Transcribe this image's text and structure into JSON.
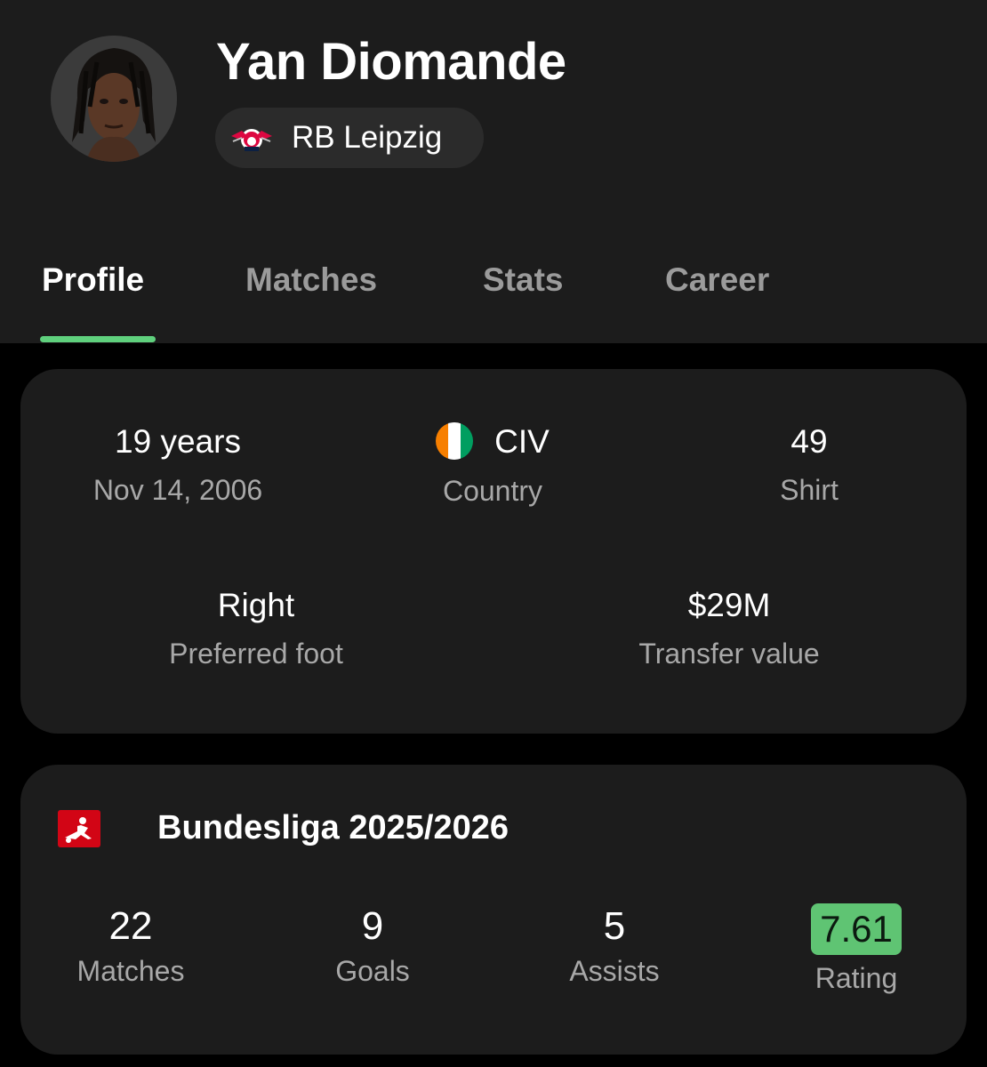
{
  "player": {
    "name": "Yan Diomande",
    "team": "RB Leipzig",
    "avatar_icon": "player-photo"
  },
  "tabs": [
    {
      "label": "Profile",
      "active": true
    },
    {
      "label": "Matches",
      "active": false
    },
    {
      "label": "Stats",
      "active": false
    },
    {
      "label": "Career",
      "active": false
    }
  ],
  "info": {
    "age": {
      "value": "19 years",
      "label": "Nov 14, 2006"
    },
    "country": {
      "value": "CIV",
      "label": "Country",
      "flag_icon": "ivory-coast-flag-icon"
    },
    "shirt": {
      "value": "49",
      "label": "Shirt"
    },
    "foot": {
      "value": "Right",
      "label": "Preferred foot"
    },
    "transfer": {
      "value": "$29M",
      "label": "Transfer value"
    }
  },
  "league": {
    "title": "Bundesliga 2025/2026",
    "logo_icon": "bundesliga-logo-icon",
    "stats": [
      {
        "value": "22",
        "label": "Matches"
      },
      {
        "value": "9",
        "label": "Goals"
      },
      {
        "value": "5",
        "label": "Assists"
      },
      {
        "value": "7.61",
        "label": "Rating"
      }
    ]
  },
  "colors": {
    "accent": "#5fd07d",
    "rating_badge": "#5fc473",
    "card_background": "#1c1c1c",
    "page_background": "#000000"
  }
}
